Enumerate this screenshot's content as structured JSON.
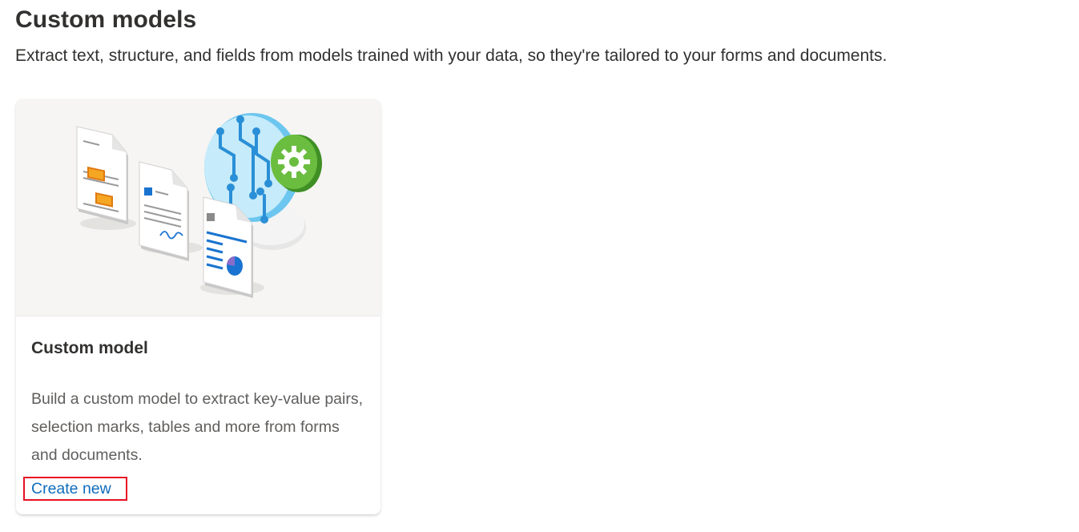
{
  "header": {
    "title": "Custom models",
    "subtitle": "Extract text, structure, and fields from models trained with your data, so they're tailored to your forms and documents."
  },
  "card": {
    "image_icon": "custom-model-illustration",
    "title": "Custom model",
    "description": "Build a custom model to extract key-value pairs, selection marks, tables and more from forms and documents.",
    "link_label": "Create new"
  },
  "colors": {
    "link": "#0f6cbd",
    "highlight_border": "#e81123",
    "image_background": "#f6f5f3"
  }
}
